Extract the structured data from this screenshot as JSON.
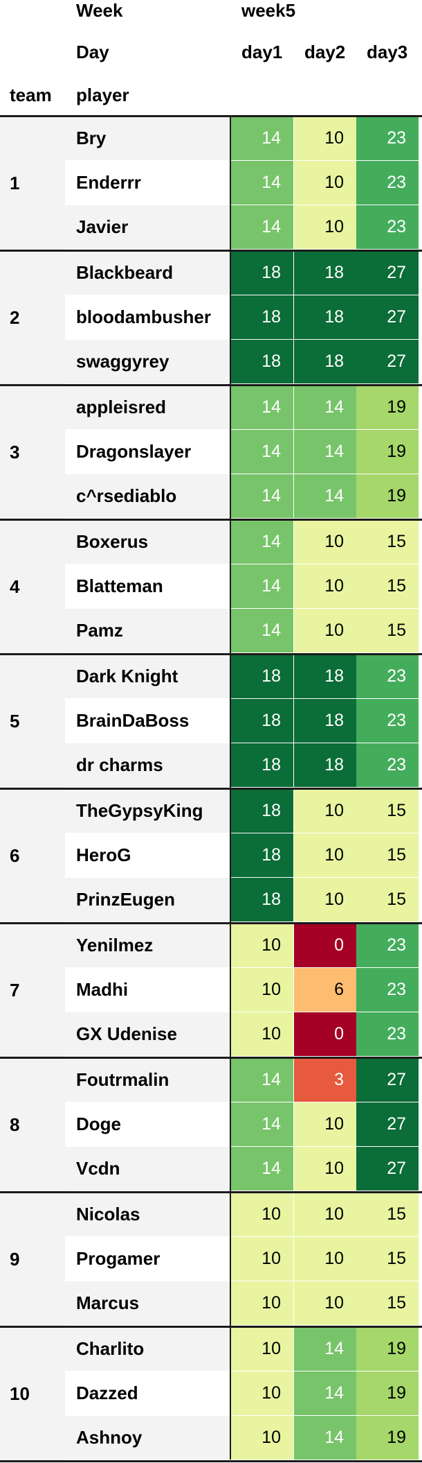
{
  "header": {
    "week_label": "Week",
    "week_value": "week5",
    "day_label": "Day",
    "team_label": "team",
    "player_label": "player"
  },
  "colors": {
    "0": "#a50026",
    "3": "#e75a3f",
    "6": "#fdbc6f",
    "10": "#e8f4a0",
    "14": "#78c46a",
    "15": "#e8f4a0",
    "18": "#0b6d37",
    "19": "#a5d76a",
    "23": "#44ad5c",
    "27": "#0b6d37"
  },
  "chart_data": {
    "type": "table",
    "week": "week5",
    "days": [
      "day1",
      "day2",
      "day3"
    ],
    "teams": [
      {
        "team": "1",
        "players": [
          {
            "name": "Bry",
            "values": [
              14,
              10,
              23
            ]
          },
          {
            "name": "Enderrr",
            "values": [
              14,
              10,
              23
            ]
          },
          {
            "name": "Javier",
            "values": [
              14,
              10,
              23
            ]
          }
        ]
      },
      {
        "team": "2",
        "players": [
          {
            "name": "Blackbeard",
            "values": [
              18,
              18,
              27
            ]
          },
          {
            "name": "bloodambusher",
            "values": [
              18,
              18,
              27
            ]
          },
          {
            "name": "swaggyrey",
            "values": [
              18,
              18,
              27
            ]
          }
        ]
      },
      {
        "team": "3",
        "players": [
          {
            "name": "appleisred",
            "values": [
              14,
              14,
              19
            ]
          },
          {
            "name": "Dragonslayer",
            "values": [
              14,
              14,
              19
            ]
          },
          {
            "name": "c^rsediablo",
            "values": [
              14,
              14,
              19
            ]
          }
        ]
      },
      {
        "team": "4",
        "players": [
          {
            "name": "Boxerus",
            "values": [
              14,
              10,
              15
            ]
          },
          {
            "name": "Blatteman",
            "values": [
              14,
              10,
              15
            ]
          },
          {
            "name": "Pamz",
            "values": [
              14,
              10,
              15
            ]
          }
        ]
      },
      {
        "team": "5",
        "players": [
          {
            "name": "Dark Knight",
            "values": [
              18,
              18,
              23
            ]
          },
          {
            "name": "BrainDaBoss",
            "values": [
              18,
              18,
              23
            ]
          },
          {
            "name": "dr charms",
            "values": [
              18,
              18,
              23
            ]
          }
        ]
      },
      {
        "team": "6",
        "players": [
          {
            "name": "TheGypsyKing",
            "values": [
              18,
              10,
              15
            ]
          },
          {
            "name": "HeroG",
            "values": [
              18,
              10,
              15
            ]
          },
          {
            "name": "PrinzEugen",
            "values": [
              18,
              10,
              15
            ]
          }
        ]
      },
      {
        "team": "7",
        "players": [
          {
            "name": "Yenilmez",
            "values": [
              10,
              0,
              23
            ]
          },
          {
            "name": "Madhi",
            "values": [
              10,
              6,
              23
            ]
          },
          {
            "name": "GX Udenise",
            "values": [
              10,
              0,
              23
            ]
          }
        ]
      },
      {
        "team": "8",
        "players": [
          {
            "name": "Foutrmalin",
            "values": [
              14,
              3,
              27
            ]
          },
          {
            "name": "Doge",
            "values": [
              14,
              10,
              27
            ]
          },
          {
            "name": "Vcdn",
            "values": [
              14,
              10,
              27
            ]
          }
        ]
      },
      {
        "team": "9",
        "players": [
          {
            "name": "Nicolas",
            "values": [
              10,
              10,
              15
            ]
          },
          {
            "name": "Progamer",
            "values": [
              10,
              10,
              15
            ]
          },
          {
            "name": "Marcus",
            "values": [
              10,
              10,
              15
            ]
          }
        ]
      },
      {
        "team": "10",
        "players": [
          {
            "name": "Charlito",
            "values": [
              10,
              14,
              19
            ]
          },
          {
            "name": "Dazzed",
            "values": [
              10,
              14,
              19
            ]
          },
          {
            "name": "Ashnoy",
            "values": [
              10,
              14,
              19
            ]
          }
        ]
      }
    ]
  }
}
